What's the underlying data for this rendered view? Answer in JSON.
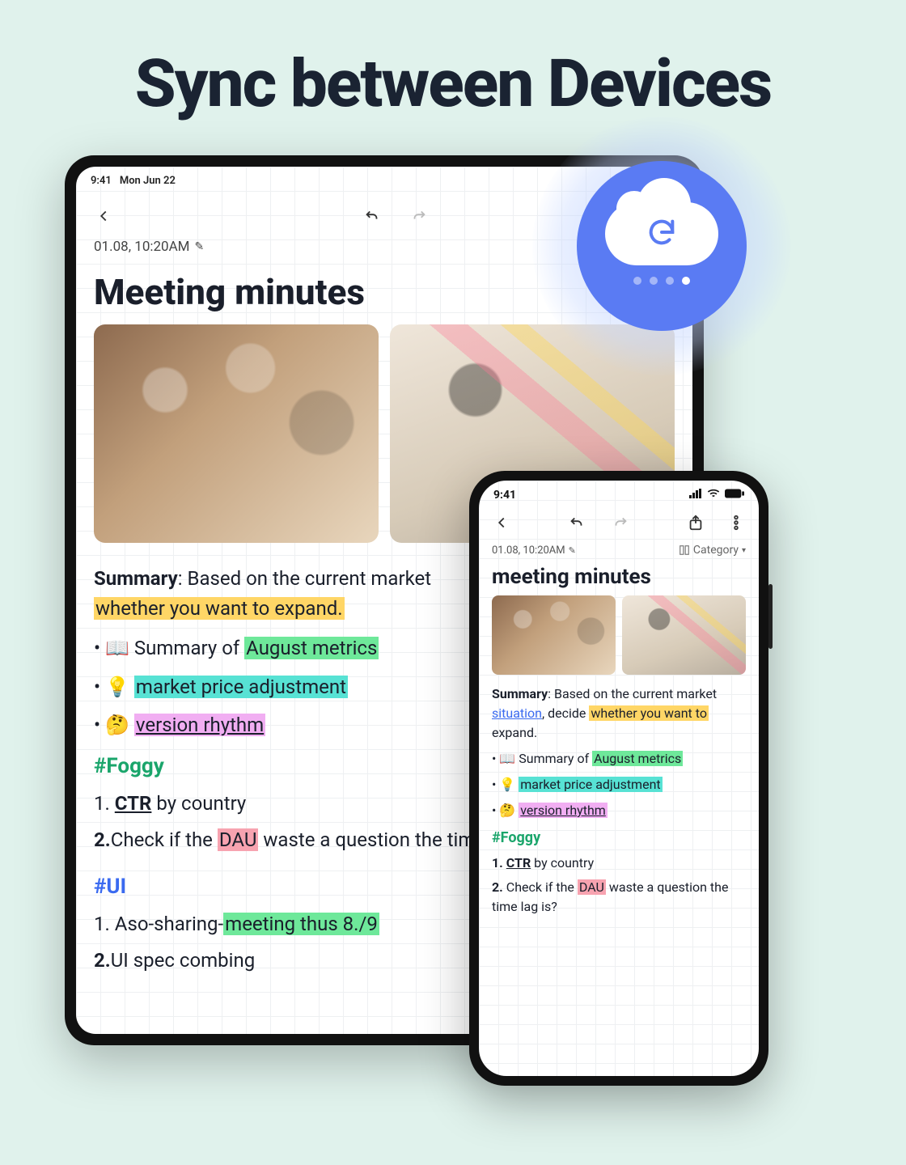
{
  "hero": {
    "title": "Sync between Devices"
  },
  "cloud_badge": {
    "icon": "cloud-sync-icon",
    "active_dot_index": 3,
    "dot_count": 4
  },
  "tablet": {
    "status": {
      "time": "9:41",
      "date": "Mon Jun 22"
    },
    "toolbar": {
      "back": "back-icon",
      "undo": "undo-icon",
      "redo": "redo-icon"
    },
    "meta": {
      "timestamp": "01.08, 10:20AM",
      "edit_icon": "pencil-icon"
    },
    "title": "Meeting minutes",
    "photos": [
      "meeting-people-photo",
      "desk-papers-photo"
    ],
    "summary": {
      "label": "Summary",
      "line1_a": ": Based on the current market",
      "hl": "whether you want to expand."
    },
    "bullets": [
      {
        "emoji": "📖",
        "pre": "Summary of ",
        "hl": "August metrics",
        "hl_class": "hl-green"
      },
      {
        "emoji": "💡",
        "pre": "",
        "hl": "market price adjustment",
        "hl_class": "hl-cyan"
      },
      {
        "emoji": "🤔",
        "pre": "",
        "hl": "version rhythm",
        "hl_class": "hl-pink"
      }
    ],
    "foggy": {
      "tag": "#Foggy",
      "items": [
        {
          "n": "1.",
          "a": "CTR",
          "b": " by country"
        },
        {
          "n": "2.",
          "a2": "Check if the ",
          "hl": "DAU",
          "b2": " waste a question the time la"
        }
      ]
    },
    "ui": {
      "tag": "#UI",
      "items": [
        {
          "n": "1.",
          "a": " Aso-sharing-",
          "hl": "meeting thus 8./9"
        },
        {
          "n": "2.",
          "a": "UI spec combing"
        }
      ]
    }
  },
  "phone": {
    "status": {
      "time": "9:41",
      "signal": "signal-icon",
      "wifi": "wifi-icon",
      "battery": "battery-icon"
    },
    "toolbar": {
      "back": "back-icon",
      "undo": "undo-icon",
      "redo": "redo-icon",
      "share": "share-icon",
      "more": "more-icon"
    },
    "meta": {
      "timestamp": "01.08, 10:20AM",
      "edit_icon": "pencil-icon",
      "category_icon": "layout-icon",
      "category_label": "Category"
    },
    "title": "meeting minutes",
    "photos": [
      "meeting-people-photo",
      "desk-papers-photo"
    ],
    "summary": {
      "label": "Summary",
      "pre": ": Based on the current market ",
      "link": "situation",
      "mid": ", decide ",
      "hl": "whether you want to",
      "post": " expand."
    },
    "bullets": [
      {
        "emoji": "📖",
        "pre": "Summary of ",
        "hl": "August metrics",
        "hl_class": "hl-green"
      },
      {
        "emoji": "💡",
        "pre": "",
        "hl": "market price adjustment",
        "hl_class": "hl-cyan"
      },
      {
        "emoji": "🤔",
        "pre": "",
        "hl": "version rhythm",
        "hl_class": "hl-pink"
      }
    ],
    "foggy": {
      "tag": "#Foggy",
      "items": [
        {
          "n": "1.",
          "a": "CTR",
          "b": " by country"
        },
        {
          "n": "2.",
          "a2": " Check if the ",
          "hl": "DAU",
          "b2": " waste a question the time lag is?"
        }
      ]
    }
  }
}
